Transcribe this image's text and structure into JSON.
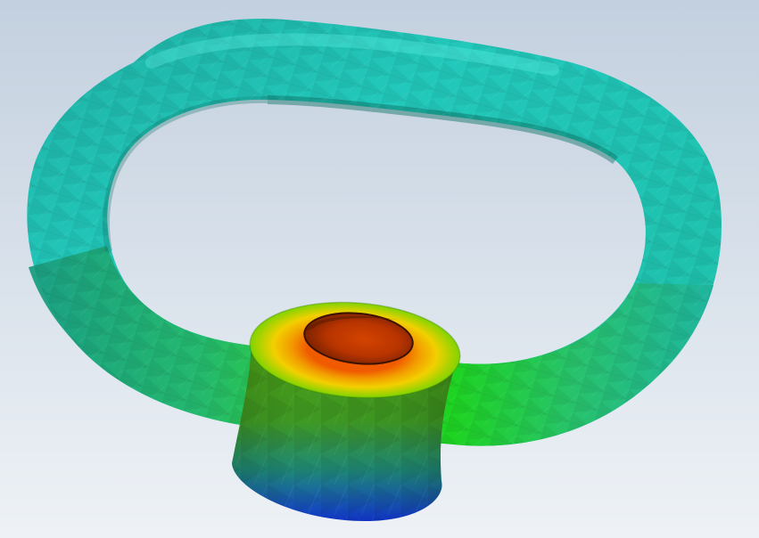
{
  "viewport": {
    "background_top": "#c3d0df",
    "background_bottom": "#eef2f6"
  },
  "model": {
    "ring_colors": {
      "top_right": "#22d6c8",
      "top_left": "#1fb0a4",
      "left": "#17a08a",
      "bottom_left": "#27b86a",
      "bottom_right": "#2ec850",
      "near_boss": "#1ed41a",
      "inner_shadow": "#0b6f62",
      "edge": "#0a5c50"
    },
    "boss_colors": {
      "side_top": "#4c9c14",
      "side_mid": "#3f9a22",
      "side_low": "#1e8a7a",
      "side_bottom": "#1034c8",
      "rim_outer": "#7fd400",
      "rim_mid": "#f2d000",
      "rim_inner": "#f05a00",
      "hole": "#9a2a00",
      "hole_center": "#d44400"
    }
  }
}
